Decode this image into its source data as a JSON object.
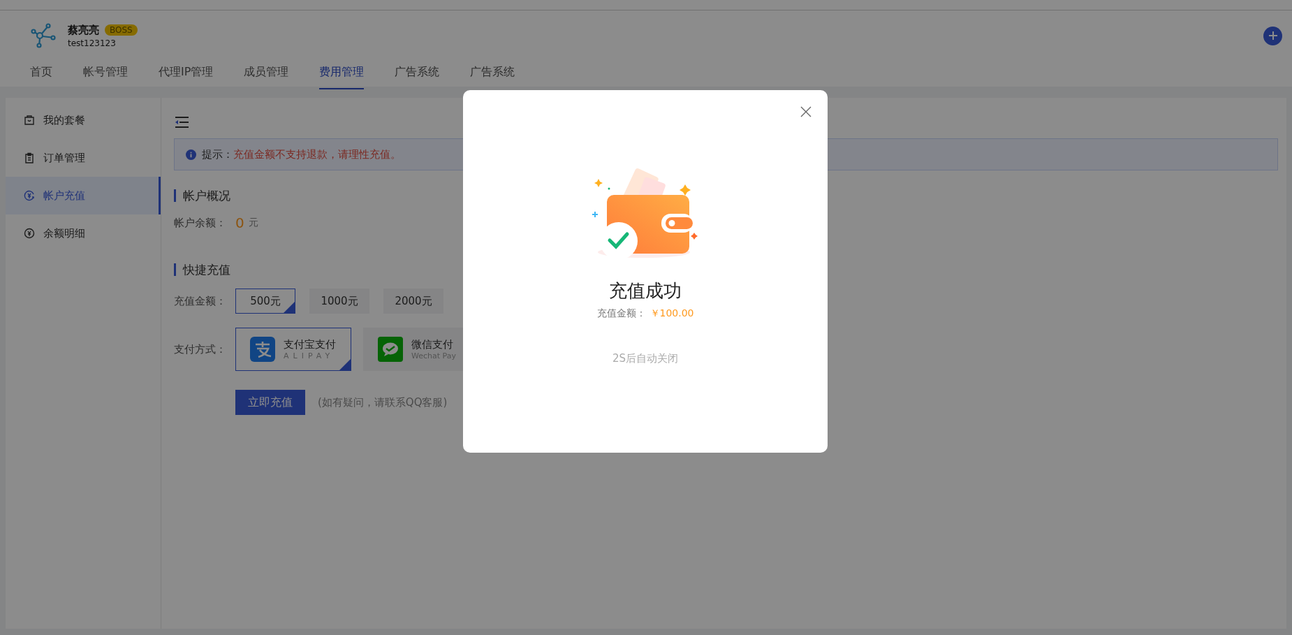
{
  "header": {
    "user_name": "蔡亮亮",
    "badge": "BOSS",
    "account": "test123123"
  },
  "nav_tabs": [
    {
      "label": "首页",
      "selected": false
    },
    {
      "label": "帐号管理",
      "selected": false
    },
    {
      "label": "代理IP管理",
      "selected": false
    },
    {
      "label": "成员管理",
      "selected": false
    },
    {
      "label": "费用管理",
      "selected": true
    },
    {
      "label": "广告系统",
      "selected": false
    },
    {
      "label": "广告系统",
      "selected": false
    }
  ],
  "sidebar": {
    "items": [
      {
        "kind": "package",
        "label": "我的套餐",
        "selected": false
      },
      {
        "kind": "orders",
        "label": "订单管理",
        "selected": false
      },
      {
        "kind": "recharge",
        "label": "帐户充值",
        "selected": true
      },
      {
        "kind": "balance",
        "label": "余额明细",
        "selected": false
      }
    ]
  },
  "notice": {
    "label": "提示：",
    "message": "充值金额不支持退款，请理性充值。"
  },
  "account_overview": {
    "title": "帐户概况",
    "balance_label": "帐户余额：",
    "balance": "0",
    "unit": "元"
  },
  "quick_recharge": {
    "title": "快捷充值",
    "amount_label": "充值金额：",
    "amounts": [
      {
        "label": "500元",
        "selected": true
      },
      {
        "label": "1000元",
        "selected": false
      },
      {
        "label": "2000元",
        "selected": false
      }
    ],
    "payment_label": "支付方式：",
    "payments": [
      {
        "kind": "alipay",
        "name": "支付宝支付",
        "subtitle": "ALIPAY",
        "selected": true
      },
      {
        "kind": "wechat",
        "name": "微信支付",
        "subtitle": "Wechat Pay",
        "selected": false
      }
    ],
    "submit": "立即充值",
    "help": "(如有疑问，请联系QQ客服)"
  },
  "dialog": {
    "title": "充值成功",
    "amount_label": "充值金额：",
    "amount": "￥100.00",
    "countdown": "2S后自动关闭"
  }
}
